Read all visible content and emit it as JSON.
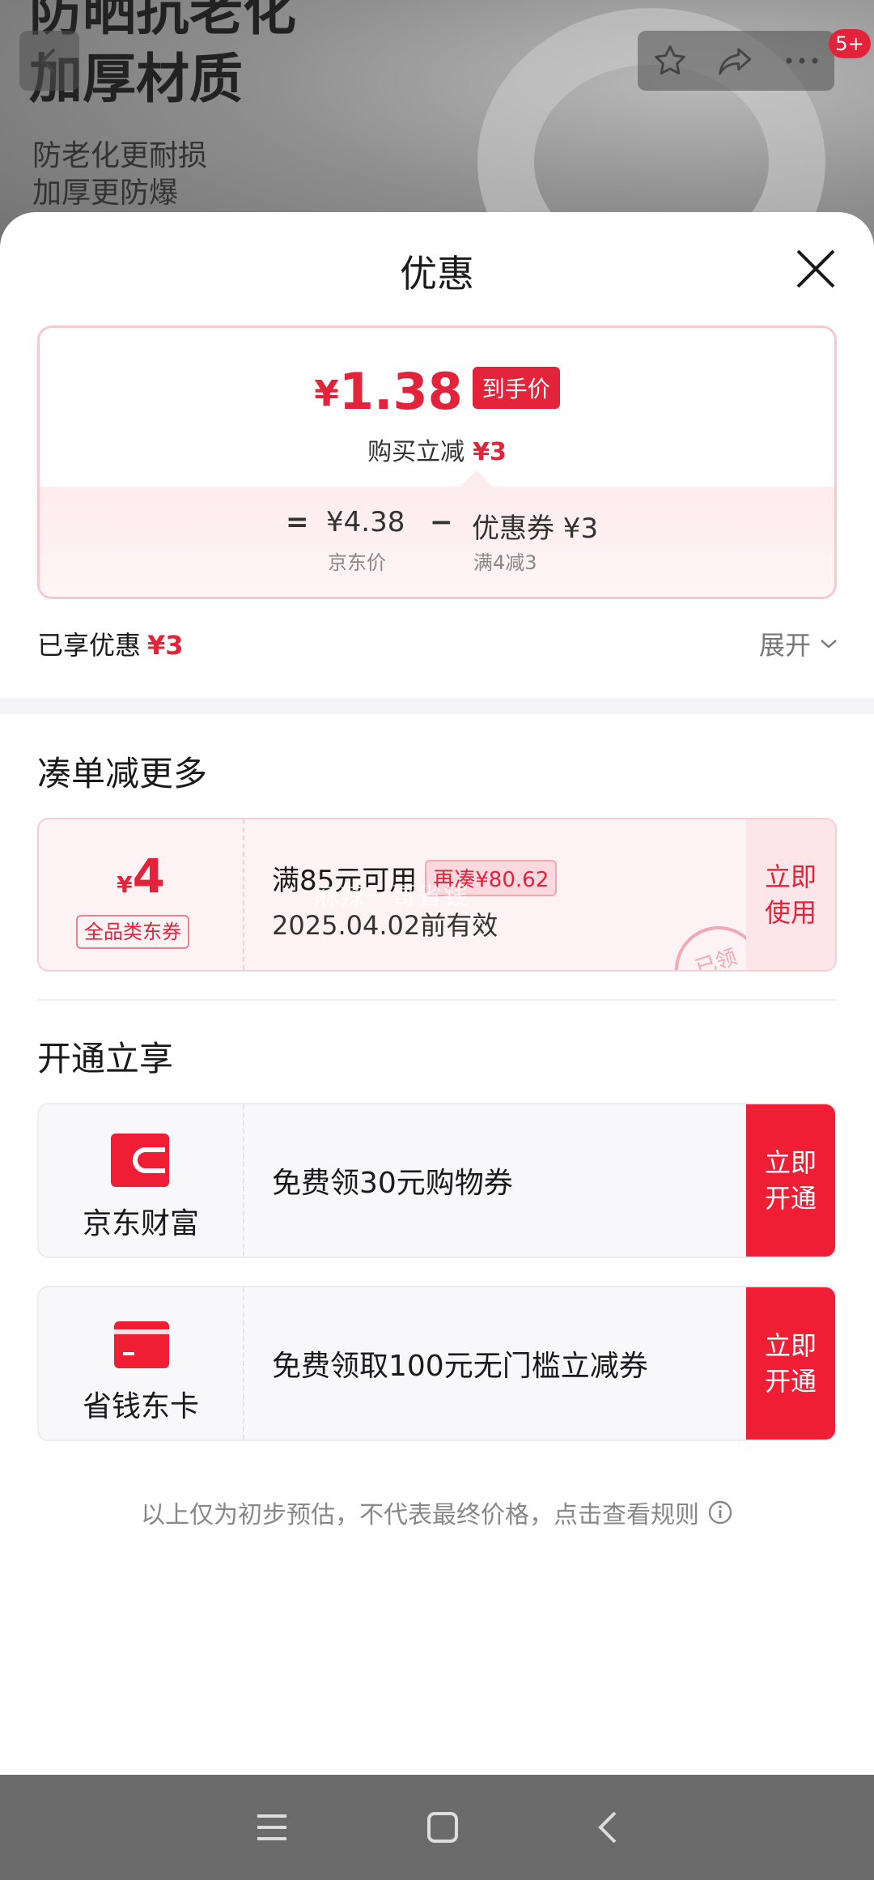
{
  "background": {
    "headline_lines": [
      "防晒抗老化",
      "加厚材质"
    ],
    "sub_lines": [
      "防老化更耐损",
      "加厚更防爆"
    ],
    "cart_badge": "5+"
  },
  "sheet": {
    "title": "优惠",
    "price": {
      "currency": "¥",
      "value": "1.38",
      "tag": "到手价",
      "reduce_label": "购买立减",
      "reduce_value": "¥3"
    },
    "calc": {
      "equals": "=",
      "jd_price": "¥4.38",
      "jd_price_label": "京东价",
      "minus": "−",
      "coupon": "优惠券 ¥3",
      "coupon_label": "满4减3"
    },
    "enjoyed_label": "已享优惠",
    "enjoyed_value": "¥3",
    "expand_label": "展开"
  },
  "more_section": {
    "title": "凑单减更多",
    "coupon": {
      "currency": "¥",
      "value": "4",
      "tag": "全品类东券",
      "condition": "满85元可用",
      "more": "再凑¥80.62",
      "expiry": "2025.04.02前有效",
      "use_label": "立即使用",
      "stamp": "已领",
      "watermark": "麻辣一哥省钱"
    }
  },
  "open_section": {
    "title": "开通立享",
    "cards": [
      {
        "name": "京东财富",
        "text": "免费领30元购物券",
        "button": "立即开通",
        "icon": "wallet-icon"
      },
      {
        "name": "省钱东卡",
        "text": "免费领取100元无门槛立减券",
        "button": "立即开通",
        "icon": "card-icon"
      }
    ]
  },
  "footnote": "以上仅为初步预估，不代表最终价格，点击查看规则",
  "colors": {
    "accent": "#e3233a",
    "button": "#f01e35"
  }
}
